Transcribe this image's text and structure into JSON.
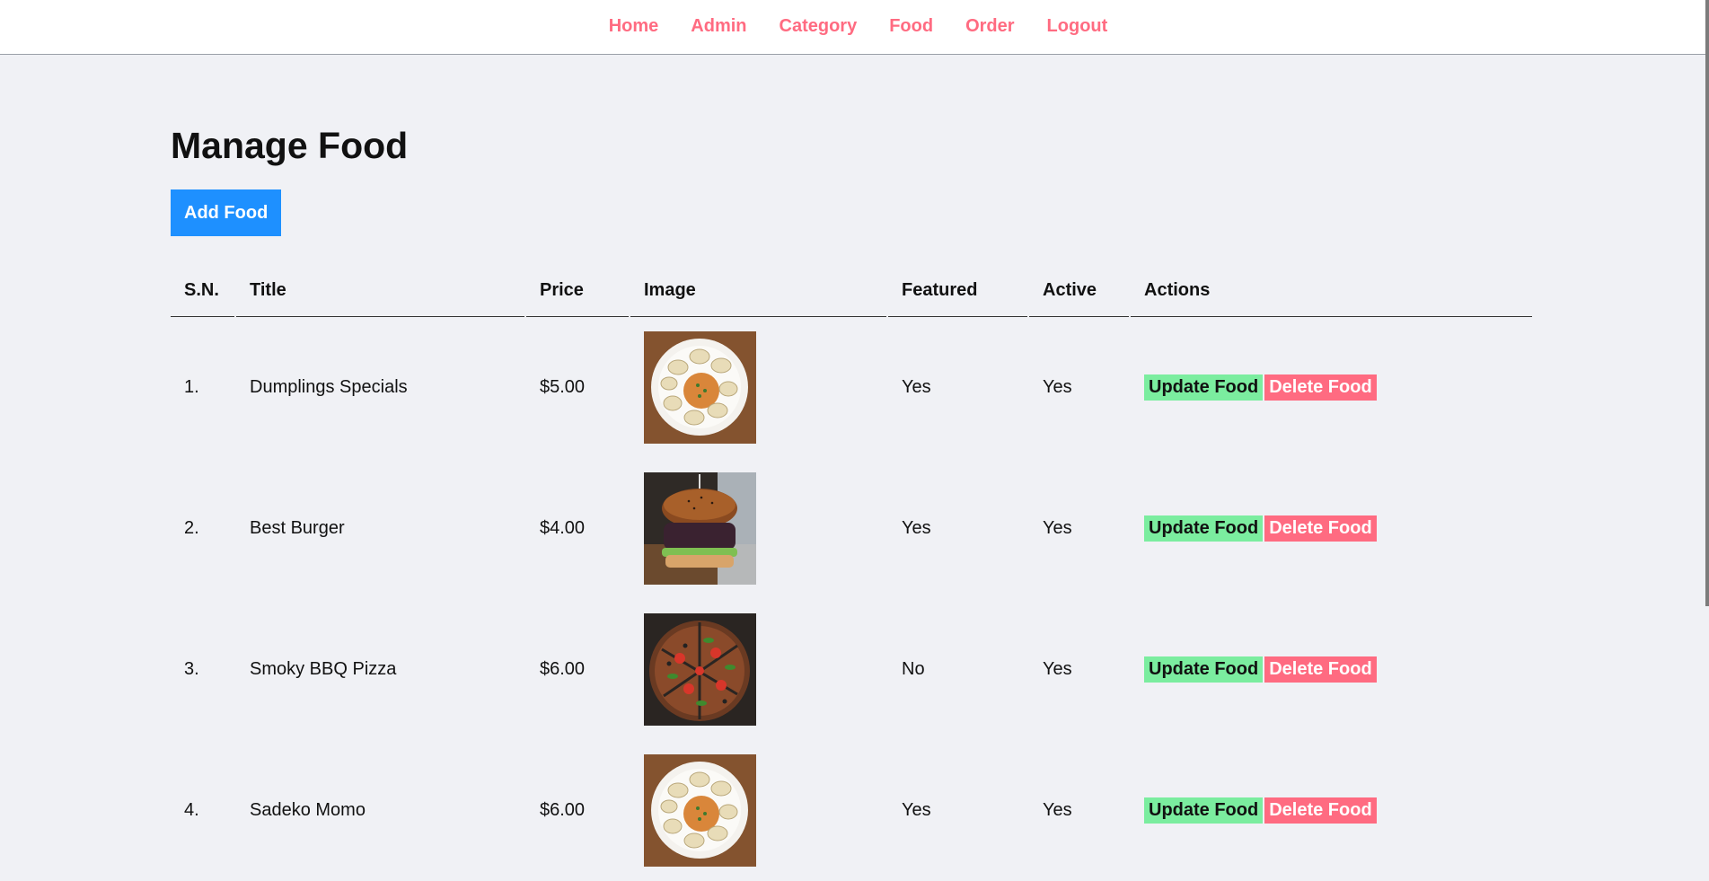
{
  "nav": {
    "items": [
      {
        "label": "Home"
      },
      {
        "label": "Admin"
      },
      {
        "label": "Category"
      },
      {
        "label": "Food"
      },
      {
        "label": "Order"
      },
      {
        "label": "Logout"
      }
    ]
  },
  "page": {
    "title": "Manage Food",
    "add_button": "Add Food"
  },
  "table": {
    "headers": {
      "sn": "S.N.",
      "title": "Title",
      "price": "Price",
      "image": "Image",
      "featured": "Featured",
      "active": "Active",
      "actions": "Actions"
    },
    "rows": [
      {
        "sn": "1.",
        "title": "Dumplings Specials",
        "price": "$5.00",
        "image": "dumplings-image",
        "featured": "Yes",
        "active": "Yes",
        "update": "Update Food",
        "delete": "Delete Food"
      },
      {
        "sn": "2.",
        "title": "Best Burger",
        "price": "$4.00",
        "image": "burger-image",
        "featured": "Yes",
        "active": "Yes",
        "update": "Update Food",
        "delete": "Delete Food"
      },
      {
        "sn": "3.",
        "title": "Smoky BBQ Pizza",
        "price": "$6.00",
        "image": "pizza-image",
        "featured": "No",
        "active": "Yes",
        "update": "Update Food",
        "delete": "Delete Food"
      },
      {
        "sn": "4.",
        "title": "Sadeko Momo",
        "price": "$6.00",
        "image": "dumplings-image",
        "featured": "Yes",
        "active": "Yes",
        "update": "Update Food",
        "delete": "Delete Food"
      }
    ]
  },
  "colors": {
    "accent": "#ff6b81",
    "primary_button": "#1e90ff",
    "update_button": "#7bed9f",
    "background": "#f0f1f5"
  }
}
